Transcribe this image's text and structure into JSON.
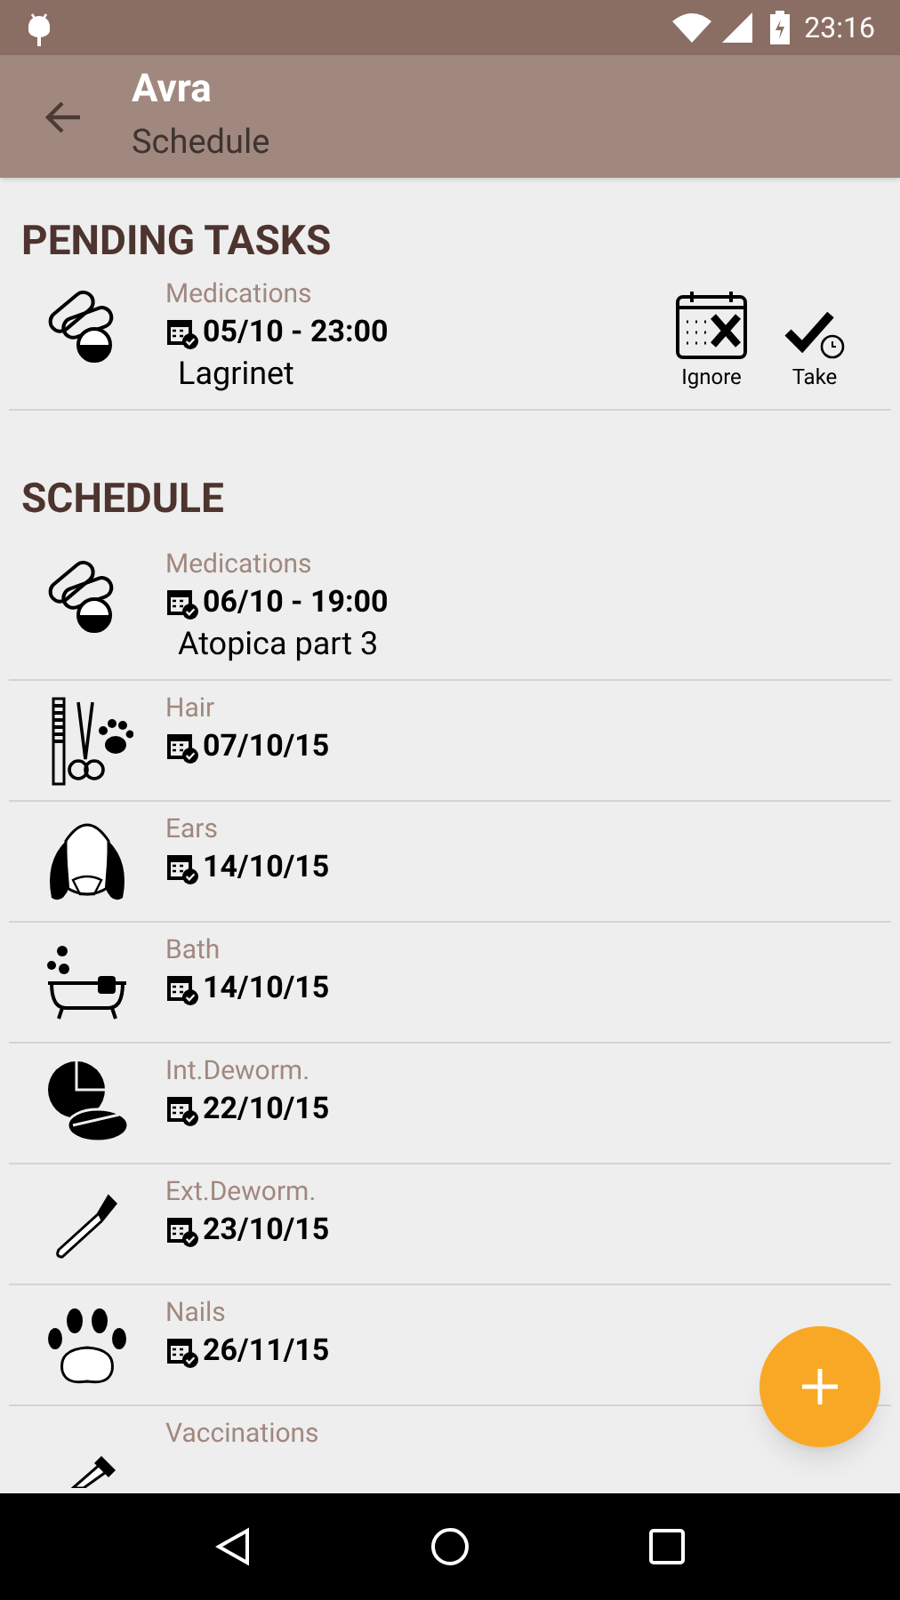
{
  "status_bar": {
    "time": "23:16"
  },
  "app_bar": {
    "title": "Avra",
    "subtitle": "Schedule"
  },
  "pending": {
    "heading": "PENDING TASKS",
    "tasks": [
      {
        "kind": "medications",
        "category": "Medications",
        "date": "05/10 - 23:00",
        "name": "Lagrinet",
        "actions": [
          "Ignore",
          "Take"
        ]
      }
    ]
  },
  "schedule": {
    "heading": "SCHEDULE",
    "items": [
      {
        "kind": "medications",
        "category": "Medications",
        "date": "06/10 - 19:00",
        "name": "Atopica part 3"
      },
      {
        "kind": "hair",
        "category": "Hair",
        "date": "07/10/15"
      },
      {
        "kind": "ears",
        "category": "Ears",
        "date": "14/10/15"
      },
      {
        "kind": "bath",
        "category": "Bath",
        "date": "14/10/15"
      },
      {
        "kind": "int_deworm",
        "category": "Int.Deworm.",
        "date": "22/10/15"
      },
      {
        "kind": "ext_deworm",
        "category": "Ext.Deworm.",
        "date": "23/10/15"
      },
      {
        "kind": "nails",
        "category": "Nails",
        "date": "26/11/15"
      },
      {
        "kind": "vaccinations",
        "category": "Vaccinations"
      }
    ]
  }
}
